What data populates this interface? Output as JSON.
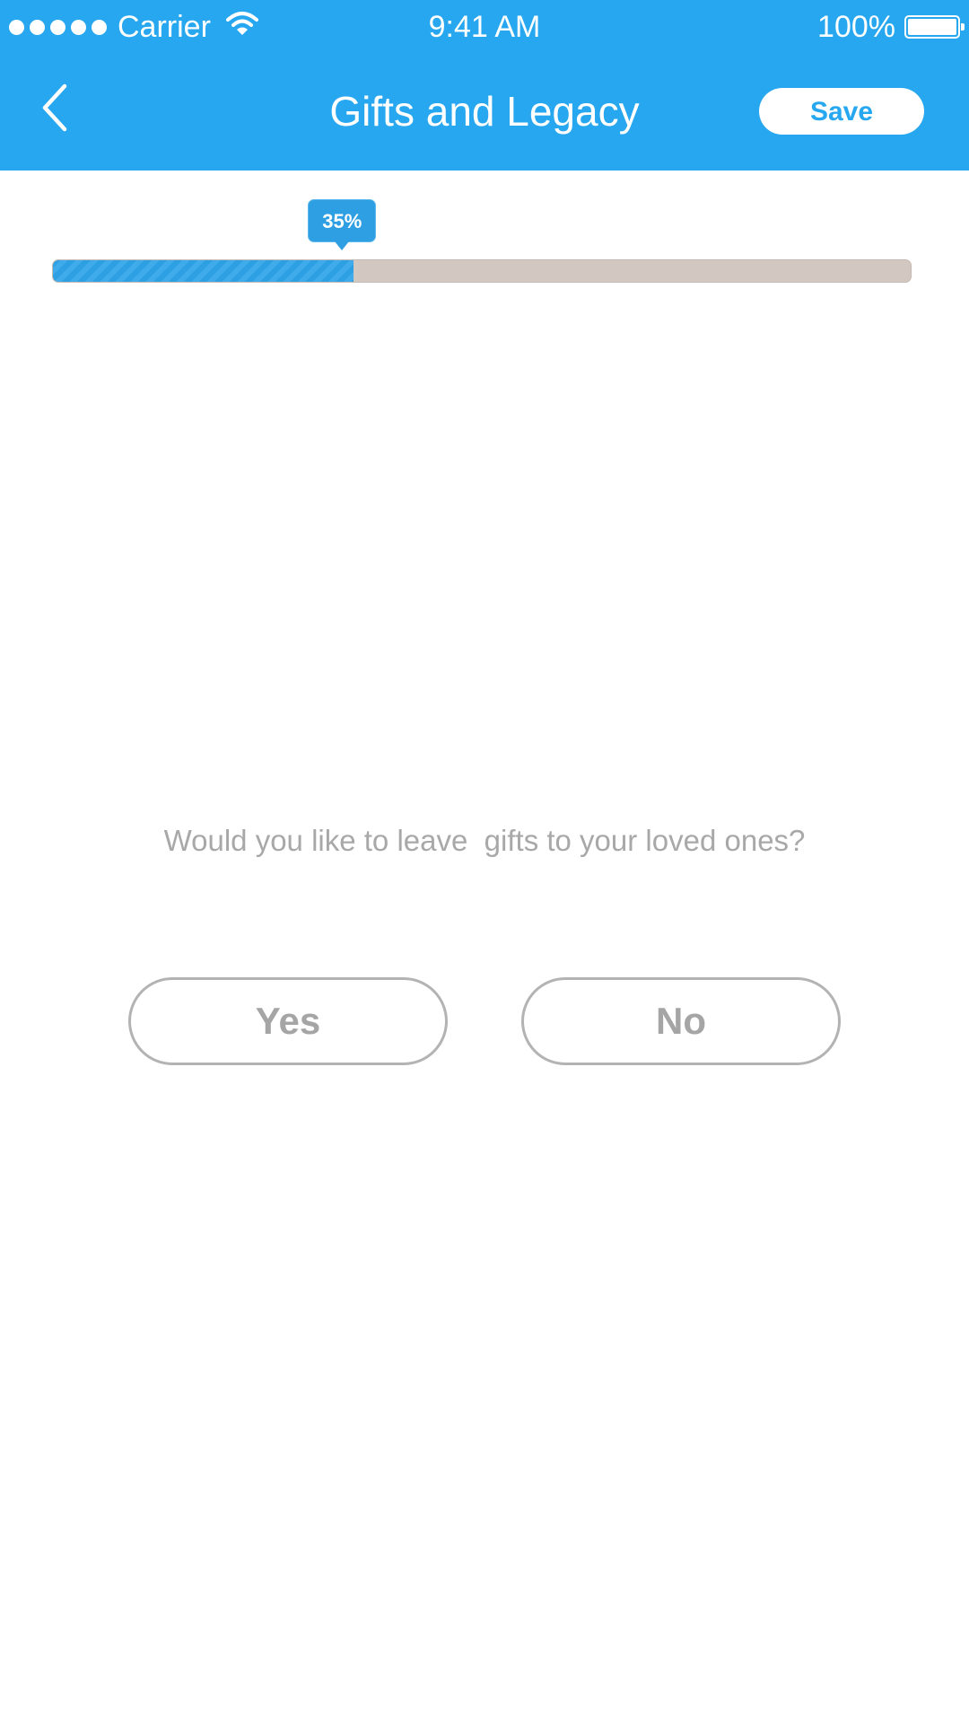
{
  "status_bar": {
    "carrier": "Carrier",
    "time": "9:41 AM",
    "battery": "100%",
    "icons": [
      "signal-dots-icon",
      "wifi-icon",
      "battery-icon"
    ]
  },
  "nav": {
    "title": "Gifts and Legacy",
    "save_label": "Save",
    "back_icon": "chevron-left-icon"
  },
  "progress": {
    "value": 0.35,
    "label": "35%"
  },
  "question": {
    "text": "Would you like to leave  gifts to your loved ones?"
  },
  "choices": {
    "yes_label": "Yes",
    "no_label": "No"
  },
  "colors": {
    "accent": "#27a7ef",
    "track": "#d3c8c1",
    "muted_text": "#a8a8a8",
    "button_border": "#b3b3b3"
  }
}
